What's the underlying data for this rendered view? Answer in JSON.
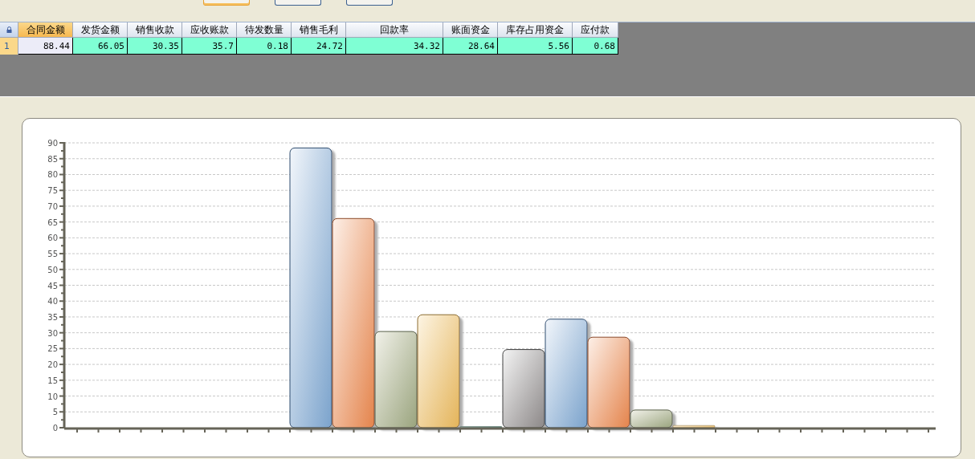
{
  "toolbar_buttons": [
    {
      "selected": true
    },
    {
      "selected": false
    },
    {
      "selected": false
    }
  ],
  "table": {
    "columns": [
      {
        "label": "合同金额",
        "selected": true
      },
      {
        "label": "发货金额",
        "selected": false
      },
      {
        "label": "销售收款",
        "selected": false
      },
      {
        "label": "应收账款",
        "selected": false
      },
      {
        "label": "待发数量",
        "selected": false
      },
      {
        "label": "销售毛利",
        "selected": false
      },
      {
        "label": "回款率",
        "selected": false
      },
      {
        "label": "账面资金",
        "selected": false
      },
      {
        "label": "库存占用资金",
        "selected": false
      },
      {
        "label": "应付款",
        "selected": false
      }
    ],
    "rows": [
      {
        "index": "1",
        "cells": [
          "88.44",
          "66.05",
          "30.35",
          "35.7",
          "0.18",
          "24.72",
          "34.32",
          "28.64",
          "5.56",
          "0.68"
        ]
      }
    ]
  },
  "chart": {
    "chart_data": {
      "type": "bar",
      "values": [
        null,
        null,
        null,
        null,
        null,
        88.4,
        66.1,
        30.4,
        35.7,
        0.2,
        24.7,
        34.3,
        28.6,
        5.6,
        0.7,
        null,
        null,
        null,
        null,
        null
      ],
      "grid": true,
      "ylim": [
        0,
        90
      ],
      "yticks": [
        0,
        5,
        10,
        15,
        20,
        25,
        30,
        35,
        40,
        45,
        50,
        55,
        60,
        65,
        70,
        75,
        80,
        85,
        90
      ]
    }
  }
}
